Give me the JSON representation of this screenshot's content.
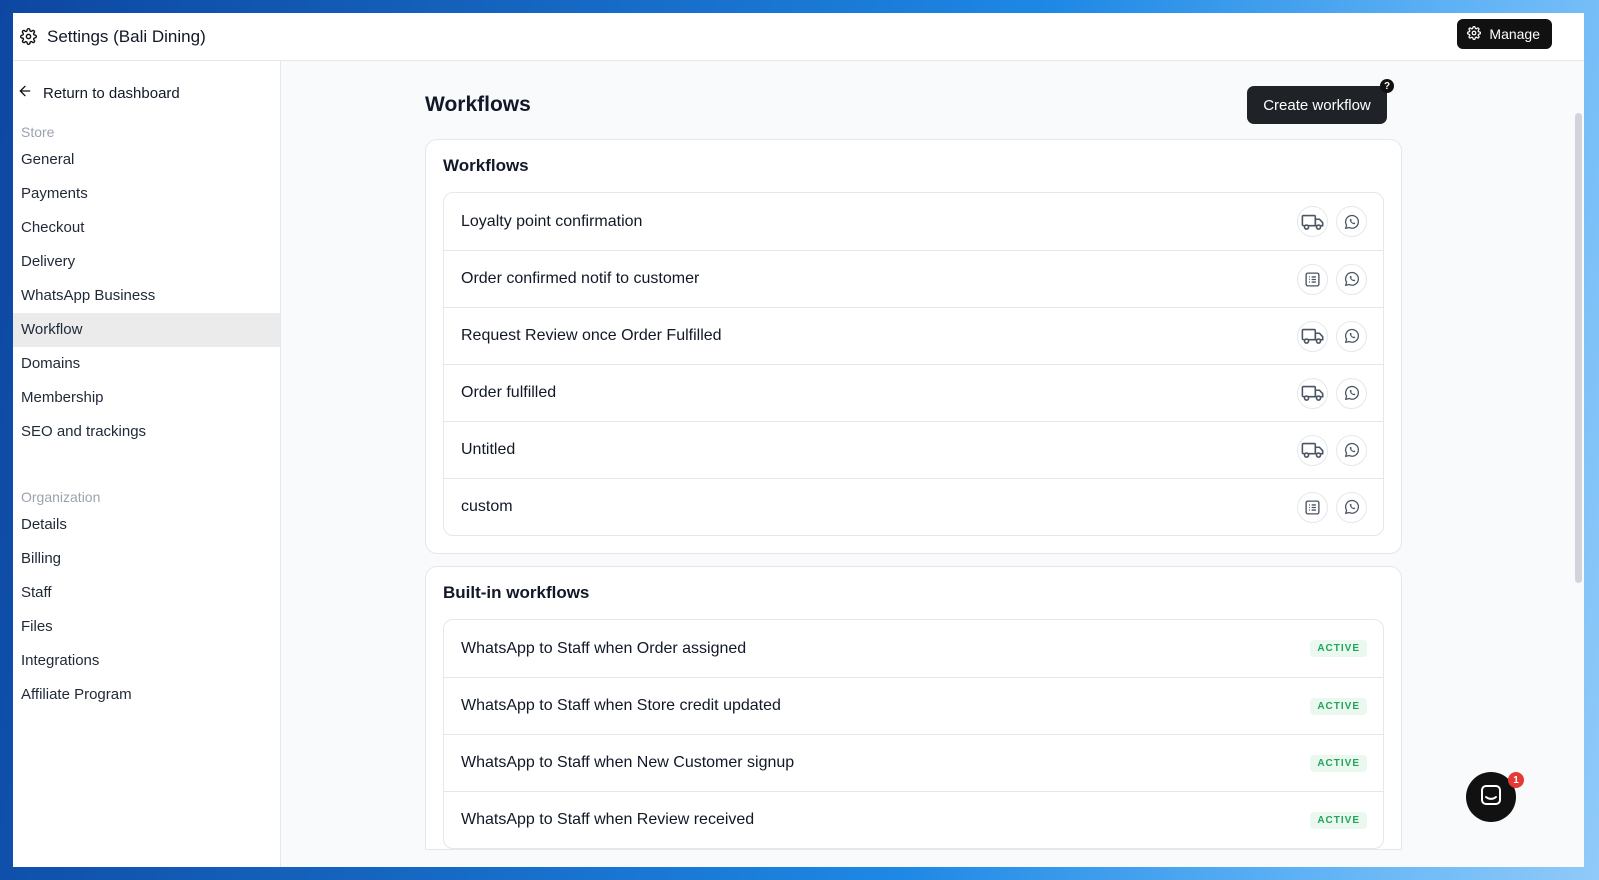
{
  "window": {
    "title": "Settings (Bali Dining)",
    "manage_label": "Manage"
  },
  "sidebar": {
    "back_label": "Return to dashboard",
    "store_label": "Store",
    "store_items": [
      "General",
      "Payments",
      "Checkout",
      "Delivery",
      "WhatsApp Business",
      "Workflow",
      "Domains",
      "Membership",
      "SEO and trackings"
    ],
    "active_item": "Workflow",
    "org_label": "Organization",
    "org_items": [
      "Details",
      "Billing",
      "Staff",
      "Files",
      "Integrations",
      "Affiliate Program"
    ]
  },
  "main": {
    "page_title": "Workflows",
    "create_label": "Create workflow",
    "help_label": "?",
    "workflows_title": "Workflows",
    "workflows": [
      {
        "label": "Loyalty point confirmation",
        "trigger_icon": "truck-icon",
        "channel_icon": "whatsapp-icon"
      },
      {
        "label": "Order confirmed notif to customer",
        "trigger_icon": "list-icon",
        "channel_icon": "whatsapp-icon"
      },
      {
        "label": "Request Review once Order Fulfilled",
        "trigger_icon": "truck-icon",
        "channel_icon": "whatsapp-icon"
      },
      {
        "label": "Order fulfilled",
        "trigger_icon": "truck-icon",
        "channel_icon": "whatsapp-icon"
      },
      {
        "label": "Untitled",
        "trigger_icon": "truck-icon",
        "channel_icon": "whatsapp-icon"
      },
      {
        "label": "custom",
        "trigger_icon": "list-icon",
        "channel_icon": "whatsapp-icon"
      }
    ],
    "builtin_title": "Built-in workflows",
    "builtin": [
      {
        "label": "WhatsApp to Staff when Order assigned",
        "status": "ACTIVE"
      },
      {
        "label": "WhatsApp to Staff when Store credit updated",
        "status": "ACTIVE"
      },
      {
        "label": "WhatsApp to Staff when New Customer signup",
        "status": "ACTIVE"
      },
      {
        "label": "WhatsApp to Staff when Review received",
        "status": "ACTIVE"
      }
    ]
  },
  "chat": {
    "unread_count": "1"
  },
  "colors": {
    "accent_dark": "#1f2328",
    "active_badge": "#22a55b",
    "notification": "#e53935"
  }
}
